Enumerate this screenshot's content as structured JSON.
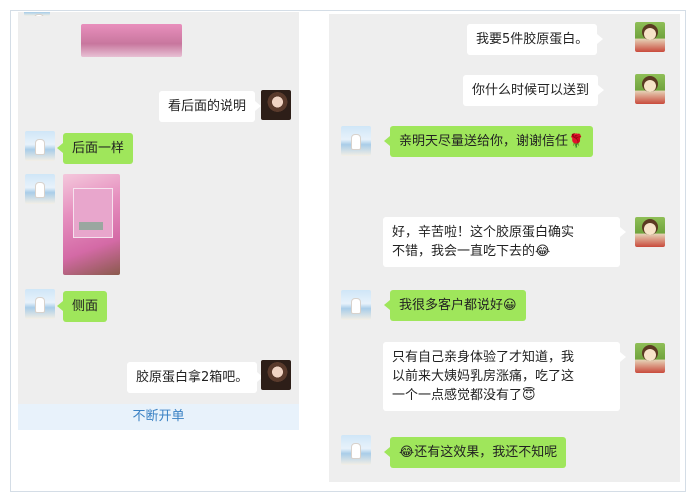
{
  "left_chat": {
    "messages": [
      {
        "text": "看后面的说明"
      },
      {
        "text": "后面一样"
      },
      {
        "text": "侧面"
      },
      {
        "text": "胶原蛋白拿2箱吧。"
      }
    ],
    "footer_button": "不断开单"
  },
  "right_chat": {
    "messages": [
      {
        "text": "我要5件胶原蛋白。"
      },
      {
        "text": "你什么时候可以送到"
      },
      {
        "text": "亲明天尽量送给你，谢谢信任",
        "emoji": "🌹"
      },
      {
        "line1": "好，辛苦啦！这个胶原蛋白确实",
        "line2": "不错，我会一直吃下去的",
        "emoji": "😂"
      },
      {
        "text": "我很多客户都说好",
        "emoji": "😀"
      },
      {
        "line1": "只有自己亲身体验了才知道，我",
        "line2": "以前来大姨妈乳房涨痛，吃了这",
        "line3": "一个一点感觉都没有了",
        "emoji": "😇"
      },
      {
        "text": "还有这效果，我还不知呢",
        "emoji": "😂"
      }
    ]
  },
  "colors": {
    "bubble_green": "#9fe65b",
    "bubble_white": "#ffffff",
    "chat_bg": "#eeeeee",
    "footer_bg": "#e8f2fb",
    "footer_text": "#3b82c4"
  }
}
